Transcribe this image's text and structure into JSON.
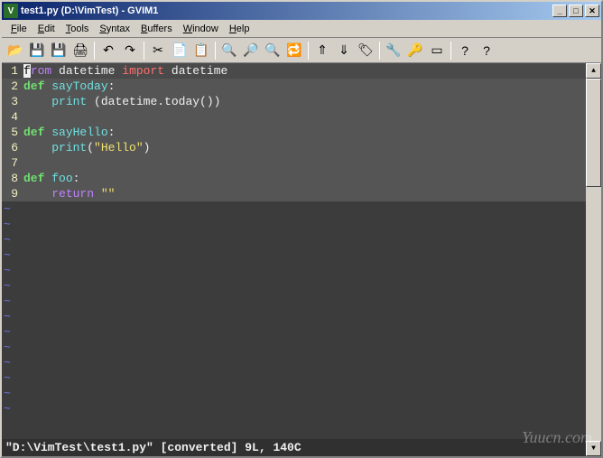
{
  "titlebar": {
    "icon_label": "Vim",
    "text": "test1.py (D:\\VimTest) - GVIM1",
    "min": "_",
    "max": "□",
    "close": "✕"
  },
  "menu": {
    "items": [
      "File",
      "Edit",
      "Tools",
      "Syntax",
      "Buffers",
      "Window",
      "Help"
    ]
  },
  "toolbar": {
    "groups": [
      [
        "open-icon",
        "save-icon",
        "saveall-icon",
        "print-icon"
      ],
      [
        "undo-icon",
        "redo-icon"
      ],
      [
        "cut-icon",
        "copy-icon",
        "paste-icon"
      ],
      [
        "find-icon",
        "findnext-icon",
        "findprev-icon",
        "replace-icon"
      ],
      [
        "jump-back-icon",
        "jump-fwd-icon",
        "tag-icon"
      ],
      [
        "make-icon",
        "shell-icon",
        "script-icon"
      ],
      [
        "help-icon",
        "findhelp-icon"
      ]
    ],
    "glyphs": {
      "open-icon": "📂",
      "save-icon": "💾",
      "saveall-icon": "💾",
      "print-icon": "🖨",
      "undo-icon": "↶",
      "redo-icon": "↷",
      "cut-icon": "✂",
      "copy-icon": "📄",
      "paste-icon": "📋",
      "find-icon": "🔍",
      "findnext-icon": "🔎",
      "findprev-icon": "🔍",
      "replace-icon": "🔁",
      "jump-back-icon": "⇑",
      "jump-fwd-icon": "⇓",
      "tag-icon": "🏷",
      "make-icon": "🔧",
      "shell-icon": "🔑",
      "script-icon": "▭",
      "help-icon": "?",
      "findhelp-icon": "?"
    }
  },
  "code": {
    "lines": [
      {
        "n": "1",
        "tokens": [
          {
            "t": "f",
            "cls": "cursor-char"
          },
          {
            "t": "rom",
            "cls": "kw"
          },
          {
            "t": " "
          },
          {
            "t": "datetime",
            "cls": ""
          },
          {
            "t": " "
          },
          {
            "t": "import",
            "cls": "kw2"
          },
          {
            "t": " "
          },
          {
            "t": "datetime",
            "cls": ""
          }
        ],
        "cursor": true
      },
      {
        "n": "2",
        "tokens": [
          {
            "t": "def",
            "cls": "def"
          },
          {
            "t": " "
          },
          {
            "t": "sayToday",
            "cls": "func"
          },
          {
            "t": ":",
            "cls": ""
          }
        ]
      },
      {
        "n": "3",
        "tokens": [
          {
            "t": "    "
          },
          {
            "t": "print",
            "cls": "builtin"
          },
          {
            "t": " (datetime.today())",
            "cls": ""
          }
        ]
      },
      {
        "n": "4",
        "tokens": []
      },
      {
        "n": "5",
        "tokens": [
          {
            "t": "def",
            "cls": "def"
          },
          {
            "t": " "
          },
          {
            "t": "sayHello",
            "cls": "func"
          },
          {
            "t": ":",
            "cls": ""
          }
        ]
      },
      {
        "n": "6",
        "tokens": [
          {
            "t": "    "
          },
          {
            "t": "print",
            "cls": "builtin"
          },
          {
            "t": "(",
            "cls": ""
          },
          {
            "t": "\"Hello\"",
            "cls": "str"
          },
          {
            "t": ")",
            "cls": ""
          }
        ]
      },
      {
        "n": "7",
        "tokens": []
      },
      {
        "n": "8",
        "tokens": [
          {
            "t": "def",
            "cls": "def"
          },
          {
            "t": " "
          },
          {
            "t": "foo",
            "cls": "func"
          },
          {
            "t": ":",
            "cls": ""
          }
        ]
      },
      {
        "n": "9",
        "tokens": [
          {
            "t": "    "
          },
          {
            "t": "return",
            "cls": "kw"
          },
          {
            "t": " "
          },
          {
            "t": "\"\"",
            "cls": "str"
          }
        ]
      }
    ],
    "tilde_count": 14
  },
  "statusbar": {
    "text": "\"D:\\VimTest\\test1.py\" [converted] 9L, 140C"
  },
  "watermark": "Yuucn.com"
}
